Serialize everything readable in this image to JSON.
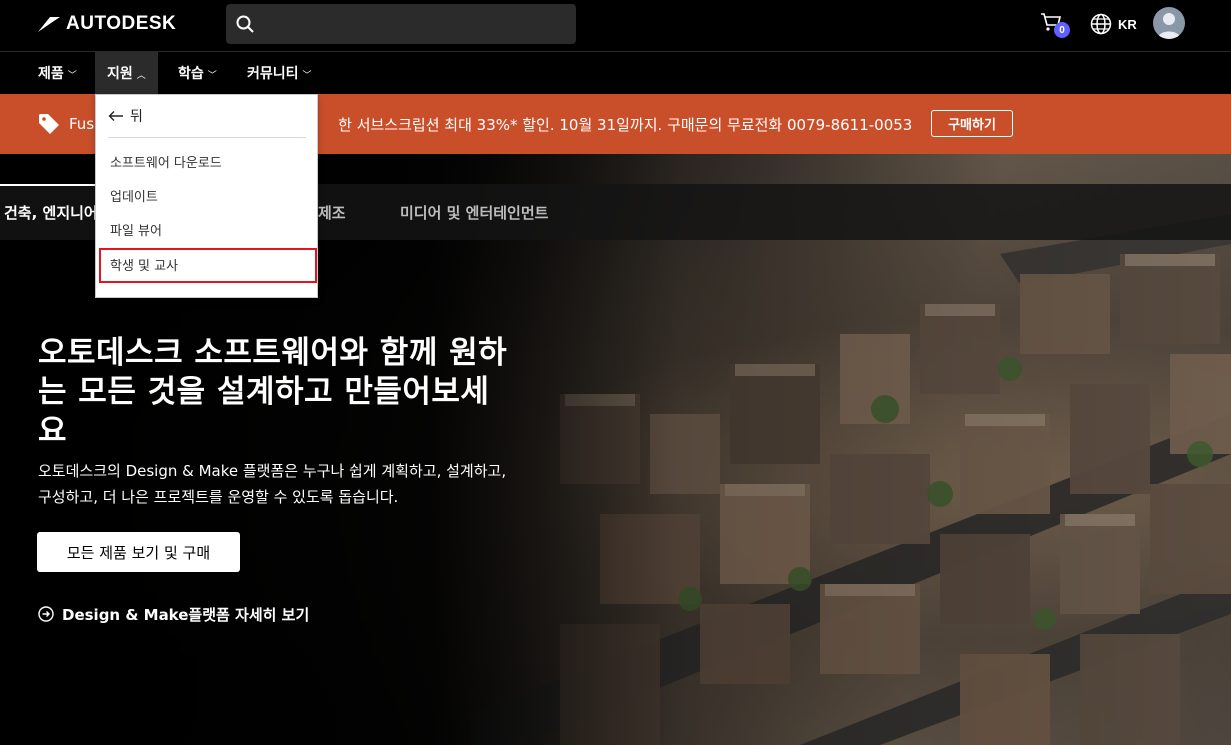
{
  "header": {
    "logo_text": "AUTODESK",
    "search_placeholder": "",
    "cart_count": "0",
    "language": "KR"
  },
  "nav": {
    "items": [
      {
        "label": "제품"
      },
      {
        "label": "지원"
      },
      {
        "label": "학습"
      },
      {
        "label": "커뮤니티"
      }
    ]
  },
  "promo": {
    "text_start": "Fus",
    "text_end": "한 서브스크립션 최대 33%* 할인. 10월 31일까지. 구매문의 무료전화 0079-8611-0053",
    "button": "구매하기",
    "color": "#c84f2a"
  },
  "dropdown": {
    "back_label": "뒤",
    "items": [
      {
        "label": "소프트웨어 다운로드"
      },
      {
        "label": "업데이트"
      },
      {
        "label": "파일 뷰어"
      },
      {
        "label": "학생 및 교사"
      }
    ],
    "highlight_color": "#e0151f"
  },
  "tabs": [
    {
      "label": "건축, 엔지니어"
    },
    {
      "label": "제조"
    },
    {
      "label": "미디어 및 엔터테인먼트"
    }
  ],
  "hero": {
    "title": "오토데스크 소프트웨어와 함께 원하는 모든 것을 설계하고 만들어보세요",
    "subtitle": "오토데스크의 Design & Make 플랫폼은 누구나 쉽게 계획하고, 설계하고, 구성하고, 더 나은 프로젝트를 운영할 수 있도록 돕습니다.",
    "cta": "모든 제품 보기 및 구매",
    "link": "Design & Make플랫폼 자세히 보기"
  },
  "colors": {
    "accent": "#5f60ff",
    "background": "#000000"
  }
}
